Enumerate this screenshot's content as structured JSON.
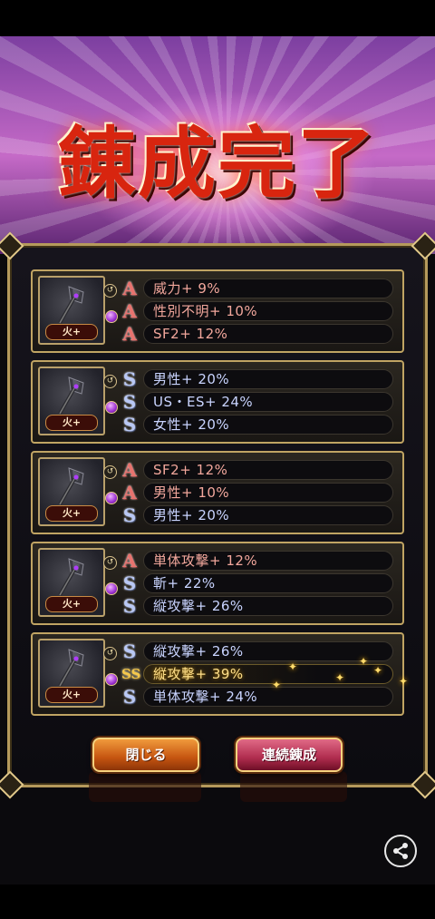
{
  "title": "錬成完了",
  "cards": [
    {
      "element_label": "火+",
      "rows": [
        {
          "rank": "A",
          "text": "威力+ 9%"
        },
        {
          "rank": "A",
          "text": "性別不明+ 10%"
        },
        {
          "rank": "A",
          "text": "SF2+ 12%"
        }
      ]
    },
    {
      "element_label": "火+",
      "rows": [
        {
          "rank": "S",
          "text": "男性+ 20%"
        },
        {
          "rank": "S",
          "text": "US・ES+ 24%"
        },
        {
          "rank": "S",
          "text": "女性+ 20%"
        }
      ]
    },
    {
      "element_label": "火+",
      "rows": [
        {
          "rank": "A",
          "text": "SF2+ 12%"
        },
        {
          "rank": "A",
          "text": "男性+ 10%"
        },
        {
          "rank": "S",
          "text": "男性+ 20%"
        }
      ]
    },
    {
      "element_label": "火+",
      "rows": [
        {
          "rank": "A",
          "text": "単体攻撃+ 12%"
        },
        {
          "rank": "S",
          "text": "斬+ 22%"
        },
        {
          "rank": "S",
          "text": "縦攻撃+ 26%"
        }
      ]
    },
    {
      "element_label": "火+",
      "rows": [
        {
          "rank": "S",
          "text": "縦攻撃+ 26%"
        },
        {
          "rank": "SS",
          "text": "縦攻撃+ 39%"
        },
        {
          "rank": "S",
          "text": "単体攻撃+ 24%"
        }
      ]
    }
  ],
  "buttons": {
    "close": "閉じる",
    "continuous": "連続錬成"
  },
  "icons": {
    "weapon": "axe-weapon-icon",
    "share": "share-icon"
  },
  "colors": {
    "rank_a": "#e8736e",
    "rank_s": "#b9c8f5",
    "rank_ss": "#f5c84a",
    "frame_gold": "#c0a463"
  }
}
